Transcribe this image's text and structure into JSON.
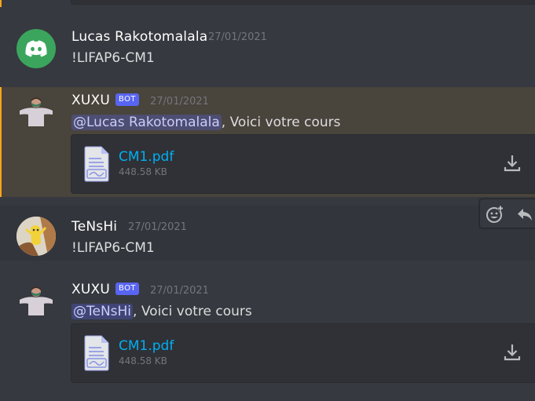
{
  "colors": {
    "background": "#36393f",
    "mention_highlight": "#49443c",
    "mention_bar": "#faa61a",
    "bot_tag": "#5865f2",
    "link": "#00aff4"
  },
  "messages": [
    {
      "author": "Lucas Rakotomalala",
      "timestamp": "27/01/2021",
      "text": "!LIFAP6-CM1",
      "avatar": "discord-logo-icon"
    },
    {
      "author": "XUXU",
      "bot_tag": "BOT",
      "timestamp": "27/01/2021",
      "mention": "@Lucas Rakotomalala",
      "text": ", Voici votre cours",
      "avatar": "person-avatar",
      "attachment": {
        "name": "CM1.pdf",
        "size": "448.58 KB"
      }
    },
    {
      "author": "TeNsHi",
      "timestamp": "27/01/2021",
      "text": "!LIFAP6-CM1",
      "avatar": "banana-avatar"
    },
    {
      "author": "XUXU",
      "bot_tag": "BOT",
      "timestamp": "27/01/2021",
      "mention": "@TeNsHi",
      "text": ", Voici votre cours",
      "avatar": "person-avatar",
      "attachment": {
        "name": "CM1.pdf",
        "size": "448.58 KB"
      }
    }
  ],
  "hover_toolbar": {
    "actions": [
      "add-reaction-icon",
      "reply-icon"
    ]
  }
}
